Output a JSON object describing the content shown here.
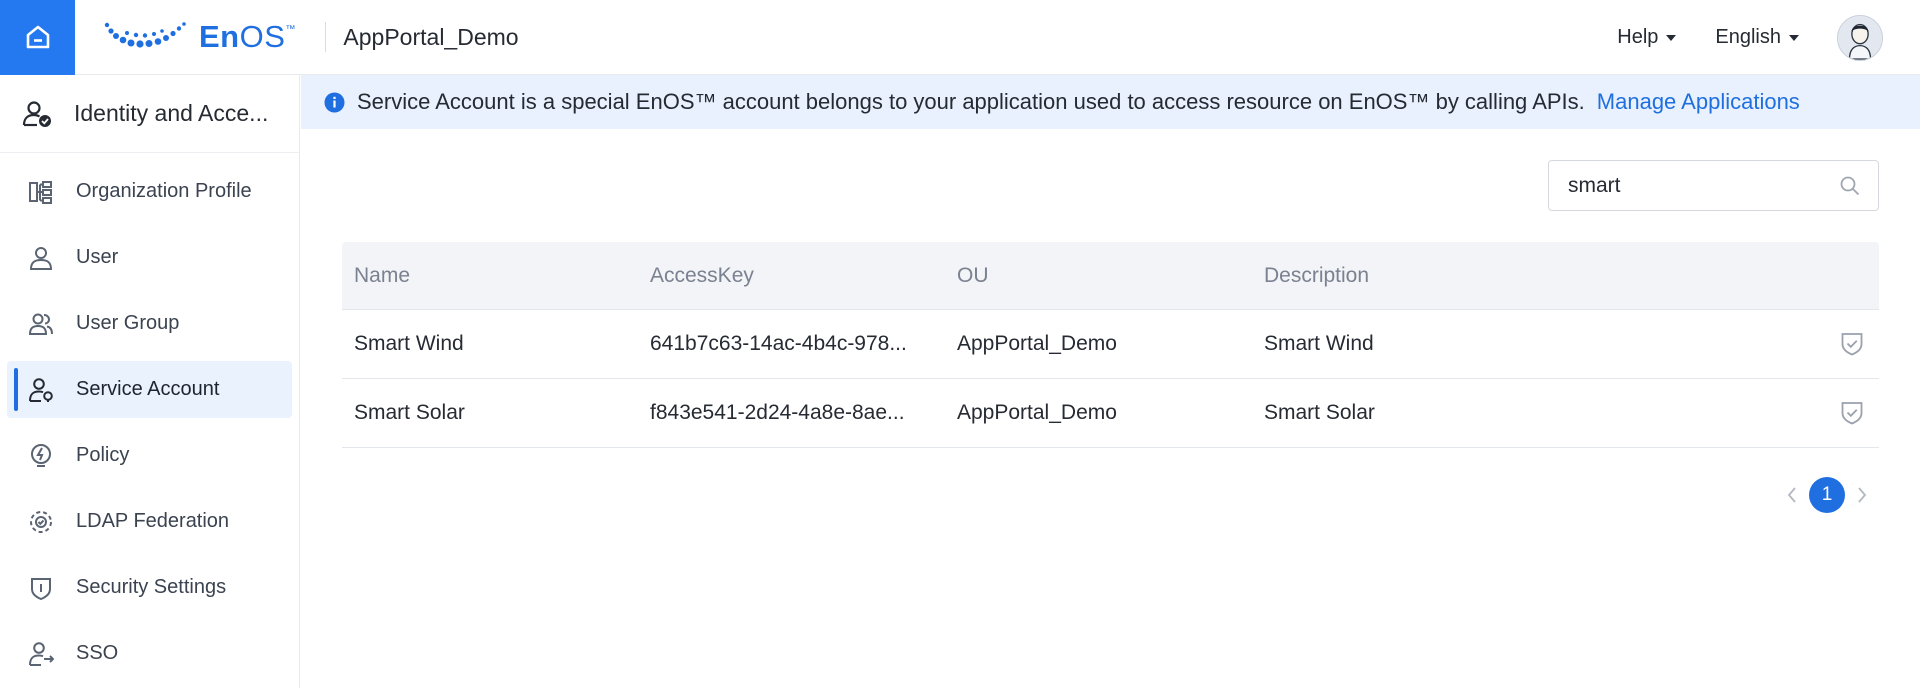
{
  "header": {
    "logo_text_en": "En",
    "logo_text_os": "OS",
    "logo_tm": "™",
    "app_name": "AppPortal_Demo",
    "help_label": "Help",
    "language_label": "English"
  },
  "sidebar": {
    "title": "Identity and Acce...",
    "items": [
      {
        "label": "Organization Profile",
        "icon": "org-profile-icon"
      },
      {
        "label": "User",
        "icon": "user-icon"
      },
      {
        "label": "User Group",
        "icon": "user-group-icon"
      },
      {
        "label": "Service Account",
        "icon": "service-account-icon",
        "active": true
      },
      {
        "label": "Policy",
        "icon": "policy-icon"
      },
      {
        "label": "LDAP Federation",
        "icon": "ldap-icon"
      },
      {
        "label": "Security Settings",
        "icon": "shield-icon"
      },
      {
        "label": "SSO",
        "icon": "sso-icon"
      }
    ]
  },
  "alert": {
    "text": "Service Account is a special EnOS™ account belongs to your application used to access resource on EnOS™ by calling APIs.",
    "link": "Manage Applications"
  },
  "search": {
    "value": "smart"
  },
  "table": {
    "columns": [
      "Name",
      "AccessKey",
      "OU",
      "Description"
    ],
    "rows": [
      {
        "name": "Smart Wind",
        "access_key": "641b7c63-14ac-4b4c-978...",
        "ou": "AppPortal_Demo",
        "description": "Smart Wind"
      },
      {
        "name": "Smart Solar",
        "access_key": "f843e541-2d24-4a8e-8ae...",
        "ou": "AppPortal_Demo",
        "description": "Smart Solar"
      }
    ]
  },
  "pagination": {
    "current_page": "1"
  },
  "colors": {
    "accent": "#1f6fe0",
    "home_bg": "#2479f0",
    "alert_bg": "#e8f1fd",
    "active_item_bg": "#eaf2fd"
  }
}
